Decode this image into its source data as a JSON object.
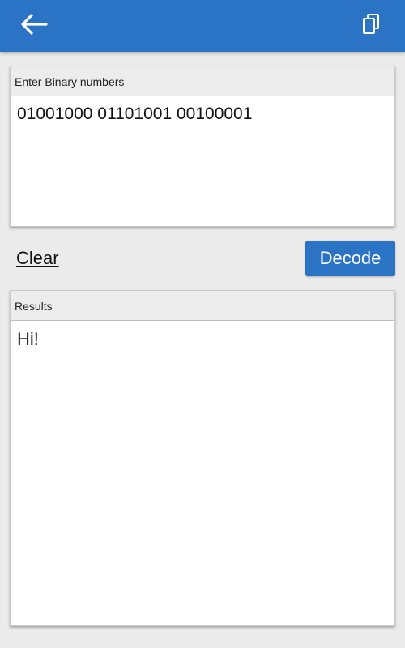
{
  "appbar": {
    "back_icon": "arrow-left-icon",
    "copy_icon": "copy-icon",
    "color": "#2a73c5"
  },
  "input_panel": {
    "label": "Enter Binary numbers",
    "value": "01001000 01101001 00100001"
  },
  "actions": {
    "clear_label": "Clear",
    "decode_label": "Decode"
  },
  "results_panel": {
    "label": "Results",
    "value": "Hi!"
  }
}
